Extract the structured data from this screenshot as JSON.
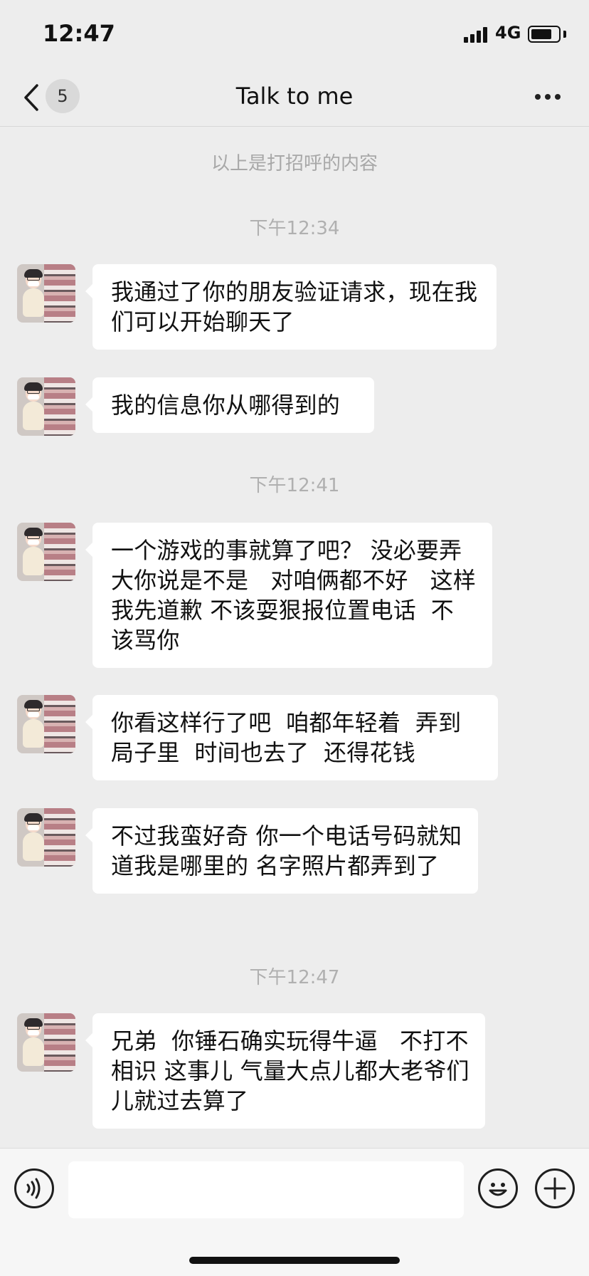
{
  "status_bar": {
    "time": "12:47",
    "network": "4G",
    "battery_level": 0.78
  },
  "nav": {
    "unread_count": "5",
    "title": "Talk to me"
  },
  "chat": {
    "greeting_notice": "以上是打招呼的内容",
    "timestamps": [
      "下午12:34",
      "下午12:41",
      "下午12:47"
    ],
    "messages": [
      {
        "text": "我通过了你的朋友验证请求，现在我们可以开始聊天了"
      },
      {
        "text": "我的信息你从哪得到的"
      },
      {
        "text": "一个游戏的事就算了吧？ 没必要弄大你说是不是   对咱俩都不好   这样 我先道歉 不该耍狠报位置电话  不该骂你"
      },
      {
        "text": "你看这样行了吧  咱都年轻着  弄到局子里  时间也去了  还得花钱"
      },
      {
        "text": "不过我蛮好奇 你一个电话号码就知道我是哪里的 名字照片都弄到了"
      },
      {
        "text": "兄弟  你锤石确实玩得牛逼   不打不相识 这事儿 气量大点儿都大老爷们儿就过去算了"
      }
    ]
  },
  "input_bar": {
    "message_value": "",
    "voice_icon": "voice-icon",
    "emoji_icon": "emoji-icon",
    "plus_icon": "plus-icon"
  },
  "colors": {
    "background": "#ededed",
    "bubble": "#ffffff",
    "timestamp_text": "#b0b0b0"
  }
}
